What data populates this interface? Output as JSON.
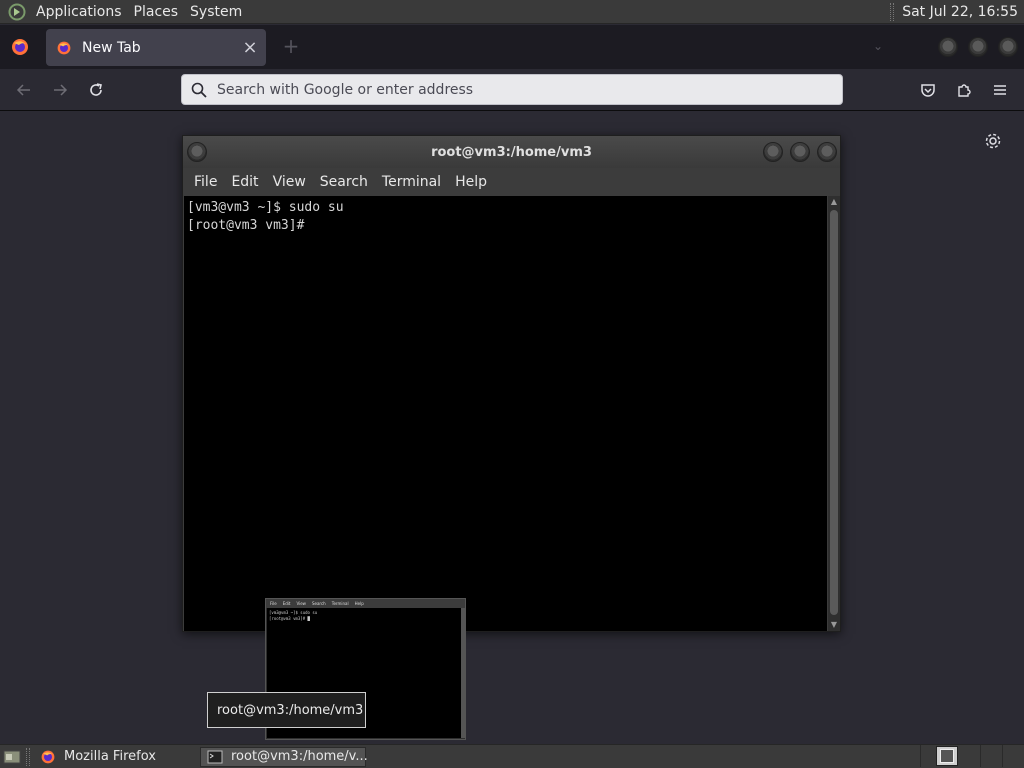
{
  "top_panel": {
    "menus": [
      "Applications",
      "Places",
      "System"
    ],
    "clock": "Sat Jul 22, 16:55"
  },
  "firefox": {
    "tab": {
      "label": "New Tab"
    },
    "urlbar": {
      "placeholder": "Search with Google or enter address"
    }
  },
  "terminal": {
    "title": "root@vm3:/home/vm3",
    "menus": [
      "File",
      "Edit",
      "View",
      "Search",
      "Terminal",
      "Help"
    ],
    "lines": [
      "[vm3@vm3 ~]$ sudo su",
      "[root@vm3 vm3]#"
    ]
  },
  "preview": {
    "menus": [
      "File",
      "Edit",
      "View",
      "Search",
      "Terminal",
      "Help"
    ],
    "lines": [
      "[vm3@vm3 ~]$ sudo su",
      "[root@vm3 vm3]# █"
    ]
  },
  "tooltip": {
    "text": "root@vm3:/home/vm3"
  },
  "taskbar": {
    "tasks": [
      {
        "label": "Mozilla Firefox",
        "icon": "firefox-icon"
      },
      {
        "label": "root@vm3:/home/v...",
        "icon": "terminal-icon"
      }
    ]
  },
  "colors": {
    "terminal_bg": "#000000",
    "panel_bg": "#3a3a3a",
    "firefox_bg": "#2b2a33"
  }
}
